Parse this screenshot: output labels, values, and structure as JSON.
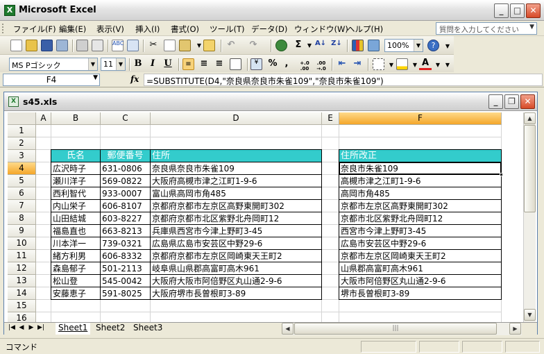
{
  "app": {
    "title": "Microsoft Excel",
    "icon": "X"
  },
  "menu": {
    "items": [
      "ファイル(F)",
      "編集(E)",
      "表示(V)",
      "挿入(I)",
      "書式(O)",
      "ツール(T)",
      "データ(D)",
      "ウィンドウ(W)",
      "ヘルプ(H)"
    ],
    "help_placeholder": "質問を入力してください"
  },
  "toolbar": {
    "zoom": "100%",
    "font_name": "MS Pゴシック",
    "font_size": "11",
    "bold": "B",
    "italic": "I",
    "underline": "U",
    "percent": "%",
    "comma": ",",
    "inc_decimal": "+.0 .00",
    "dec_decimal": ".00 →.0",
    "sigma": "Σ"
  },
  "formula_bar": {
    "name_box": "F4",
    "fx": "fx",
    "formula": "=SUBSTITUTE(D4,\"奈良県奈良市朱雀109\",\"奈良市朱雀109\")"
  },
  "workbook": {
    "title": "s45.xls",
    "columns": [
      "A",
      "B",
      "C",
      "D",
      "E",
      "F"
    ],
    "rows": [
      "1",
      "2",
      "3",
      "4",
      "5",
      "6",
      "7",
      "8",
      "9",
      "10",
      "11",
      "12",
      "13",
      "14",
      "15",
      "16"
    ],
    "table_headers": {
      "name": "氏名",
      "postal": "郵便番号",
      "address": "住所",
      "fixed": "住所改正"
    },
    "records": [
      {
        "name": "広沢時子",
        "postal": "631-0806",
        "address": "奈良県奈良市朱雀109",
        "fixed": "奈良市朱雀109"
      },
      {
        "name": "瀬川洋子",
        "postal": "569-0822",
        "address": "大阪府高槻市津之江町1-9-6",
        "fixed": "高槻市津之江町1-9-6"
      },
      {
        "name": "西利智代",
        "postal": "933-0007",
        "address": "富山県高岡市角485",
        "fixed": "高岡市角485"
      },
      {
        "name": "内山栄子",
        "postal": "606-8107",
        "address": "京都府京都市左京区高野東開町302",
        "fixed": "京都市左京区高野東開町302"
      },
      {
        "name": "山田結城",
        "postal": "603-8227",
        "address": "京都府京都市北区紫野北舟岡町12",
        "fixed": "京都市北区紫野北舟岡町12"
      },
      {
        "name": "福島直也",
        "postal": "663-8213",
        "address": "兵庫県西宮市今津上野町3-45",
        "fixed": "西宮市今津上野町3-45"
      },
      {
        "name": "川本洋一",
        "postal": "739-0321",
        "address": "広島県広島市安芸区中野29-6",
        "fixed": "広島市安芸区中野29-6"
      },
      {
        "name": "緒方利男",
        "postal": "606-8332",
        "address": "京都府京都市左京区岡崎東天王町2",
        "fixed": "京都市左京区岡崎東天王町2"
      },
      {
        "name": "森島郁子",
        "postal": "501-2113",
        "address": "岐阜県山県郡高富町高木961",
        "fixed": "山県郡高富町高木961"
      },
      {
        "name": "松山登",
        "postal": "545-0042",
        "address": "大阪府大阪市阿倍野区丸山通2-9-6",
        "fixed": "大阪市阿倍野区丸山通2-9-6"
      },
      {
        "name": "安藤恵子",
        "postal": "591-8025",
        "address": "大阪府堺市長曽根町3-89",
        "fixed": "堺市長曽根町3-89"
      }
    ],
    "sheets": [
      "Sheet1",
      "Sheet2",
      "Sheet3"
    ],
    "active_sheet": "Sheet1"
  },
  "status": {
    "text": "コマンド"
  },
  "colors": {
    "header_fill": "#33cccc",
    "active_header": "#f4a62a"
  }
}
